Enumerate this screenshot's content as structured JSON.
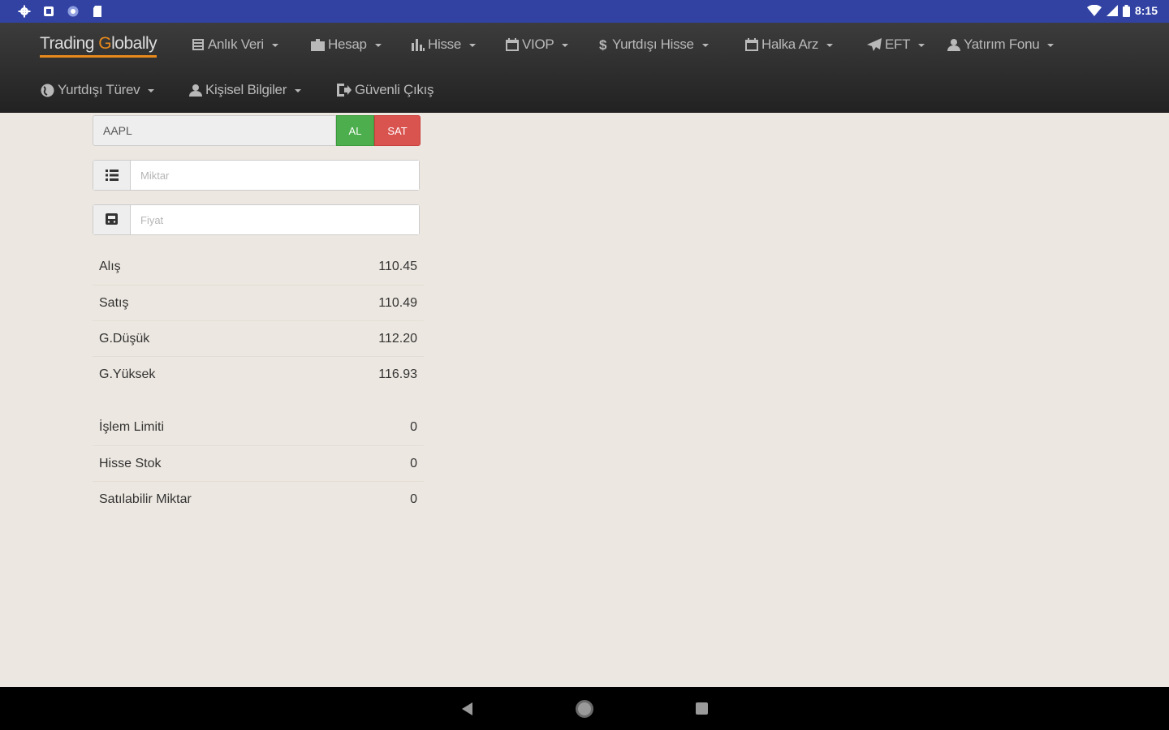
{
  "status_bar": {
    "left_icons": [
      "settings-icon",
      "sim-icon",
      "circle-icon",
      "sd-card-icon"
    ],
    "right_icons": [
      "wifi-icon",
      "signal-icon",
      "battery-icon"
    ],
    "time": "8:15"
  },
  "navbar": {
    "brand_prefix": "Trading ",
    "brand_accent": "G",
    "brand_suffix": "lobally",
    "brand_accent_color": "#e8891c",
    "items": [
      {
        "label": "Anlık Veri",
        "icon": "table-icon"
      },
      {
        "label": "Hesap",
        "icon": "briefcase-icon"
      },
      {
        "label": "Hisse",
        "icon": "bar-chart-icon"
      },
      {
        "label": "VIOP",
        "icon": "calendar-icon"
      },
      {
        "label": "Yurtdışı Hisse",
        "icon": "dollar-icon"
      },
      {
        "label": "Halka Arz",
        "icon": "calendar-icon"
      },
      {
        "label": "EFT",
        "icon": "send-icon"
      },
      {
        "label": "Yatırım Fonu",
        "icon": "user-icon"
      },
      {
        "label": "Yurtdışı Türev",
        "icon": "globe-icon"
      },
      {
        "label": "Kişisel Bilgiler",
        "icon": "user-icon"
      },
      {
        "label": "Güvenli Çıkış",
        "icon": "logout-icon"
      }
    ]
  },
  "order_form": {
    "symbol_value": "AAPL",
    "buy_label": "AL",
    "sell_label": "SAT",
    "buy_color": "#4cae4c",
    "sell_color": "#d9534f",
    "quantity_placeholder": "Miktar",
    "quantity_icon": "list-icon",
    "price_placeholder": "Fiyat",
    "price_icon": "train-icon"
  },
  "quotes": [
    {
      "label": "Alış",
      "value": "110.45"
    },
    {
      "label": "Satış",
      "value": "110.49"
    },
    {
      "label": "G.Düşük",
      "value": "112.20"
    },
    {
      "label": "G.Yüksek",
      "value": "116.93"
    }
  ],
  "limits": [
    {
      "label": "İşlem Limiti",
      "value": "0"
    },
    {
      "label": "Hisse Stok",
      "value": "0"
    },
    {
      "label": "Satılabilir Miktar",
      "value": "0"
    }
  ],
  "system_nav": {
    "buttons": [
      "back-icon",
      "home-icon",
      "recents-icon"
    ]
  }
}
